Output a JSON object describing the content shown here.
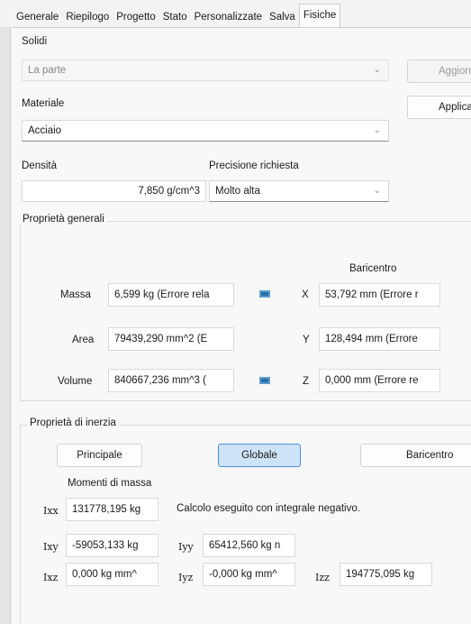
{
  "tabs": [
    "Generale",
    "Riepilogo",
    "Progetto",
    "Stato",
    "Personalizzate",
    "Salva",
    "Fisiche"
  ],
  "active_tab": "Fisiche",
  "solidi": {
    "label": "Solidi",
    "value": "La parte",
    "button_label": "Aggiorna"
  },
  "materiale": {
    "label": "Materiale",
    "value": "Acciaio",
    "button_label": "Applica"
  },
  "densita": {
    "label": "Densità",
    "value": "7,850 g/cm^3"
  },
  "precisione": {
    "label": "Precisione richiesta",
    "value": "Molto alta"
  },
  "proprieta_generali": {
    "title": "Proprietà generali",
    "baricentro_label": "Baricentro",
    "massa_label": "Massa",
    "massa_value": "6,599 kg (Errore rela",
    "area_label": "Area",
    "area_value": "79439,290 mm^2 (E",
    "volume_label": "Volume",
    "volume_value": "840667,236 mm^3 (",
    "x_label": "X",
    "x_value": "53,792 mm (Errore r",
    "y_label": "Y",
    "y_value": "128,494 mm (Errore",
    "z_label": "Z",
    "z_value": "0,000 mm (Errore re"
  },
  "proprieta_inerzia": {
    "title": "Proprietà di inerzia",
    "btn_principale": "Principale",
    "btn_globale": "Globale",
    "btn_baricentro": "Baricentro",
    "momenti_label": "Momenti di massa",
    "calcolo_note": "Calcolo eseguito con integrale negativo.",
    "ixx_label": "Ixx",
    "ixx_value": "131778,195 kg",
    "ixy_label": "Ixy",
    "ixy_value": "-59053,133 kg",
    "iyy_label": "Iyy",
    "iyy_value": "65412,560 kg n",
    "ixz_label": "Ixz",
    "ixz_value": "0,000 kg mm^",
    "iyz_label": "Iyz",
    "iyz_value": "-0,000 kg mm^",
    "izz_label": "Izz",
    "izz_value": "194775,095 kg"
  },
  "icons": {
    "chevron": "chevron-down-icon",
    "copy": "copy-icon"
  }
}
